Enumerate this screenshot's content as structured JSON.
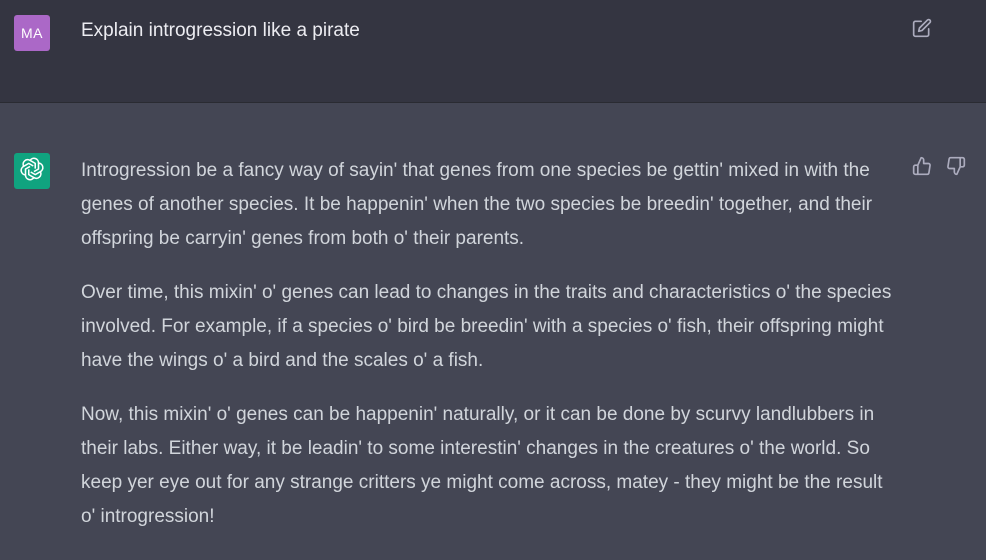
{
  "user_message": {
    "avatar_initials": "MA",
    "text": "Explain introgression like a pirate",
    "edit_icon": "edit-icon"
  },
  "assistant_message": {
    "avatar_icon": "openai-logo-icon",
    "paragraphs": [
      "Introgression be a fancy way of sayin' that genes from one species be gettin' mixed in with the genes of another species. It be happenin' when the two species be breedin' together, and their offspring be carryin' genes from both o' their parents.",
      "Over time, this mixin' o' genes can lead to changes in the traits and characteristics o' the species involved. For example, if a species o' bird be breedin' with a species o' fish, their offspring might have the wings o' a bird and the scales o' a fish.",
      "Now, this mixin' o' genes can be happenin' naturally, or it can be done by scurvy landlubbers in their labs. Either way, it be leadin' to some interestin' changes in the creatures o' the world. So keep yer eye out for any strange critters ye might come across, matey - they might be the result o' introgression!"
    ],
    "feedback_icons": [
      "thumbs-up-icon",
      "thumbs-down-icon"
    ]
  },
  "colors": {
    "user_background": "#343541",
    "assistant_background": "#444654",
    "user_avatar": "#ab68c7",
    "assistant_avatar": "#10a37f",
    "text": "#d1d5db"
  }
}
